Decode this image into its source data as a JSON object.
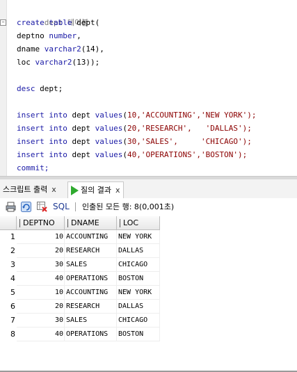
{
  "editor": {
    "comment": "--dept 테이블",
    "create_kw": "create table",
    "create_rest": " dept(",
    "col1_name": "deptno",
    "col1_type": "number",
    "col2_name": "dname",
    "col2_type": "varchar2",
    "col2_len": "(14),",
    "col3_name": "loc",
    "col3_type": "varchar2",
    "col3_len": "(13));",
    "desc_kw": "desc",
    "desc_rest": " dept;",
    "inserts": [
      {
        "kw1": "insert",
        "kw2": "into",
        "table": " dept ",
        "kw3": "values",
        "open": "(",
        "no": "10",
        "rest": ",'ACCOUNTING','NEW YORK');"
      },
      {
        "kw1": "insert",
        "kw2": "into",
        "table": " dept ",
        "kw3": "values",
        "open": "(",
        "no": "20",
        "rest": ",'RESEARCH',   'DALLAS');"
      },
      {
        "kw1": "insert",
        "kw2": "into",
        "table": " dept ",
        "kw3": "values",
        "open": "(",
        "no": "30",
        "rest": ",'SALES',     'CHICAGO');"
      },
      {
        "kw1": "insert",
        "kw2": "into",
        "table": " dept ",
        "kw3": "values",
        "open": "(",
        "no": "40",
        "rest": ",'OPERATIONS','BOSTON');"
      }
    ],
    "commit": "commit;"
  },
  "tabs": {
    "script_output": "스크립트 출력",
    "query_result": "질의 결과",
    "close_glyph": "x"
  },
  "toolbar": {
    "sql_label": "SQL",
    "fetch_status": "인출된 모든 행: 8(0,001초)"
  },
  "grid": {
    "columns": [
      "DEPTNO",
      "DNAME",
      "LOC"
    ],
    "rows": [
      {
        "n": "1",
        "deptno": "10",
        "dname": "ACCOUNTING",
        "loc": "NEW YORK"
      },
      {
        "n": "2",
        "deptno": "20",
        "dname": "RESEARCH",
        "loc": "DALLAS"
      },
      {
        "n": "3",
        "deptno": "30",
        "dname": "SALES",
        "loc": "CHICAGO"
      },
      {
        "n": "4",
        "deptno": "40",
        "dname": "OPERATIONS",
        "loc": "BOSTON"
      },
      {
        "n": "5",
        "deptno": "10",
        "dname": "ACCOUNTING",
        "loc": "NEW YORK"
      },
      {
        "n": "6",
        "deptno": "20",
        "dname": "RESEARCH",
        "loc": "DALLAS"
      },
      {
        "n": "7",
        "deptno": "30",
        "dname": "SALES",
        "loc": "CHICAGO"
      },
      {
        "n": "8",
        "deptno": "40",
        "dname": "OPERATIONS",
        "loc": "BOSTON"
      }
    ]
  },
  "colors": {
    "keyword": "#1a1aa6",
    "comment": "#7a7a7a",
    "literal": "#8b0000",
    "run_green": "#2faa2f"
  }
}
